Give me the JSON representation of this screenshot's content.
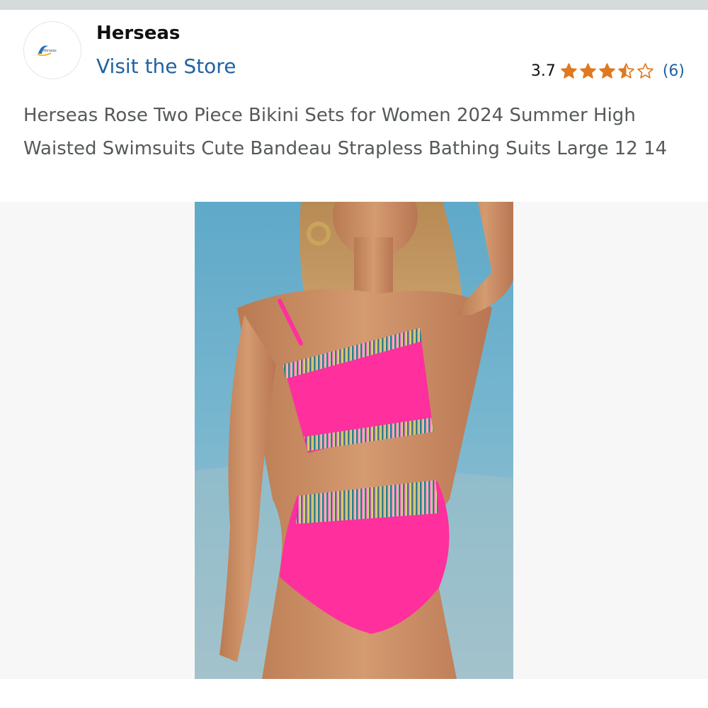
{
  "header": {
    "brand_name": "Herseas",
    "brand_logo_text": "Herseas",
    "visit_store_label": "Visit the Store"
  },
  "rating": {
    "value_text": "3.7",
    "value": 3.7,
    "max": 5,
    "count_text": "(6)",
    "star_color": "#de7921"
  },
  "product": {
    "title": "Herseas Rose Two Piece Bikini Sets for Women 2024 Summer High Waisted Swimsuits Cute Bandeau Strapless Bathing Suits Large 12 14",
    "image_icon": "product-photo"
  },
  "colors": {
    "link": "#2162a1",
    "title_text": "#565959",
    "image_background": "#f7f7f7"
  }
}
